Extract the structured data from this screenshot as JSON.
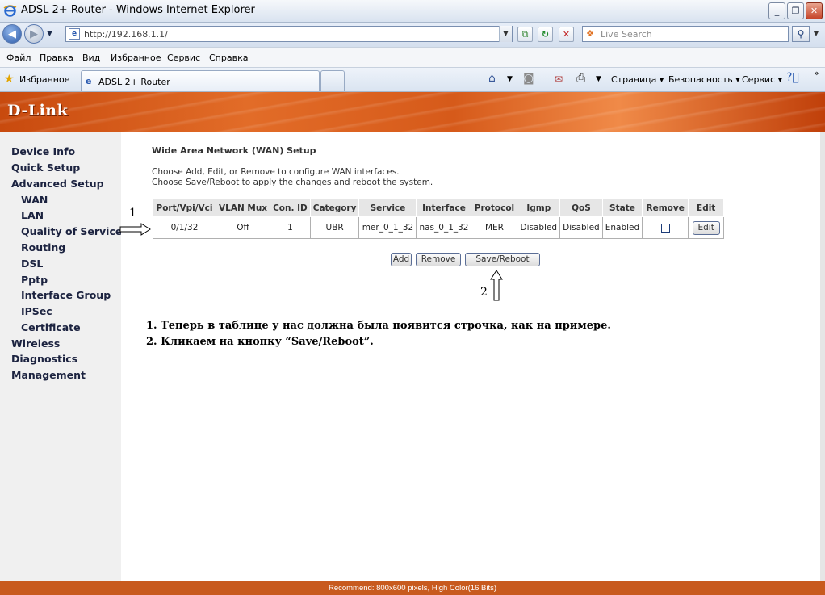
{
  "window": {
    "title": "ADSL 2+ Router - Windows Internet Explorer",
    "min": "_",
    "max": "❐",
    "close": "✕"
  },
  "addressbar": {
    "url": "http://192.168.1.1/",
    "search_placeholder": "Live Search"
  },
  "menubar": {
    "items": [
      "Файл",
      "Правка",
      "Вид",
      "Избранное",
      "Сервис",
      "Справка"
    ]
  },
  "favbar": {
    "favorites_label": "Избранное",
    "tab_label": "ADSL 2+ Router",
    "commands": [
      "Страница ▾",
      "Безопасность ▾",
      "Сервис ▾"
    ]
  },
  "brand": {
    "logo": "D-Link",
    "accent": "#d4581a"
  },
  "sidebar": {
    "items": [
      {
        "label": "Device Info"
      },
      {
        "label": "Quick Setup"
      },
      {
        "label": "Advanced Setup"
      },
      {
        "label": "WAN"
      },
      {
        "label": "LAN"
      },
      {
        "label": "Quality of Service"
      },
      {
        "label": "Routing"
      },
      {
        "label": "DSL"
      },
      {
        "label": "Pptp"
      },
      {
        "label": "Interface Group"
      },
      {
        "label": "IPSec"
      },
      {
        "label": "Certificate"
      },
      {
        "label": "Wireless"
      },
      {
        "label": "Diagnostics"
      },
      {
        "label": "Management"
      }
    ]
  },
  "main": {
    "title": "Wide Area Network (WAN) Setup",
    "desc_line1": "Choose Add, Edit, or Remove to configure WAN interfaces.",
    "desc_line2": "Choose Save/Reboot to apply the changes and reboot the system.",
    "table": {
      "headers": [
        "Port/Vpi/Vci",
        "VLAN Mux",
        "Con. ID",
        "Category",
        "Service",
        "Interface",
        "Protocol",
        "Igmp",
        "QoS",
        "State",
        "Remove",
        "Edit"
      ],
      "rows": [
        {
          "port": "0/1/32",
          "vlan_mux": "Off",
          "con_id": "1",
          "category": "UBR",
          "service": "mer_0_1_32",
          "interface": "nas_0_1_32",
          "protocol": "MER",
          "igmp": "Disabled",
          "qos": "Disabled",
          "state": "Enabled",
          "remove_checked": false,
          "edit_label": "Edit"
        }
      ]
    },
    "buttons": {
      "add": "Add",
      "remove": "Remove",
      "save_reboot": "Save/Reboot"
    }
  },
  "annotations": {
    "marker1": "1",
    "marker2": "2",
    "list": [
      "1.   Теперь в таблице у нас должна была появится строчка, как на примере.",
      "2.   Кликаем на кнопку “Save/Reboot”."
    ]
  },
  "footer": {
    "text": "Recommend: 800x600 pixels, High Color(16 Bits)"
  }
}
